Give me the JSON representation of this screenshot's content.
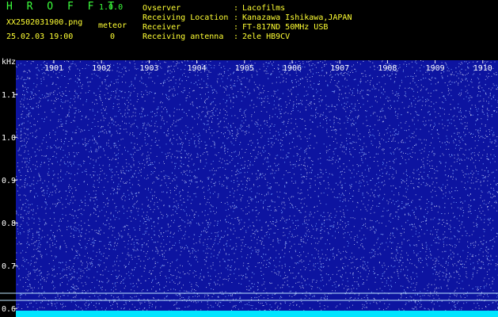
{
  "app": {
    "title": "H R O F F T",
    "version": "1.0.0"
  },
  "file": {
    "name": "XX2502031900.png",
    "datetime": "25.02.03 19:00"
  },
  "meteor": {
    "label": "meteor",
    "count": "0"
  },
  "info": [
    {
      "label": "Ovserver",
      "value": "Lacofilms"
    },
    {
      "label": "Receiving Location",
      "value": "Kanazawa Ishikawa,JAPAN"
    },
    {
      "label": "Receiver",
      "value": "FT-817ND 50MHz USB"
    },
    {
      "label": "Receiving antenna",
      "value": "2ele HB9CV"
    }
  ],
  "colors": {
    "header_green": "#3cff3c",
    "header_yellow": "#ffff33",
    "background": "#0d14a0",
    "dots": "#ffffff",
    "baseline": "#00e5ff"
  },
  "chart_data": {
    "type": "heatmap",
    "ylabel": "kHz",
    "x_ticks": [
      "1901",
      "1902",
      "1903",
      "1904",
      "1905",
      "1906",
      "1907",
      "1908",
      "1909",
      "1910"
    ],
    "y_ticks": [
      "1.1",
      "1.0",
      "0.9",
      "0.8",
      "0.7",
      "0.6"
    ],
    "ylim": [
      0.58,
      1.18
    ]
  }
}
